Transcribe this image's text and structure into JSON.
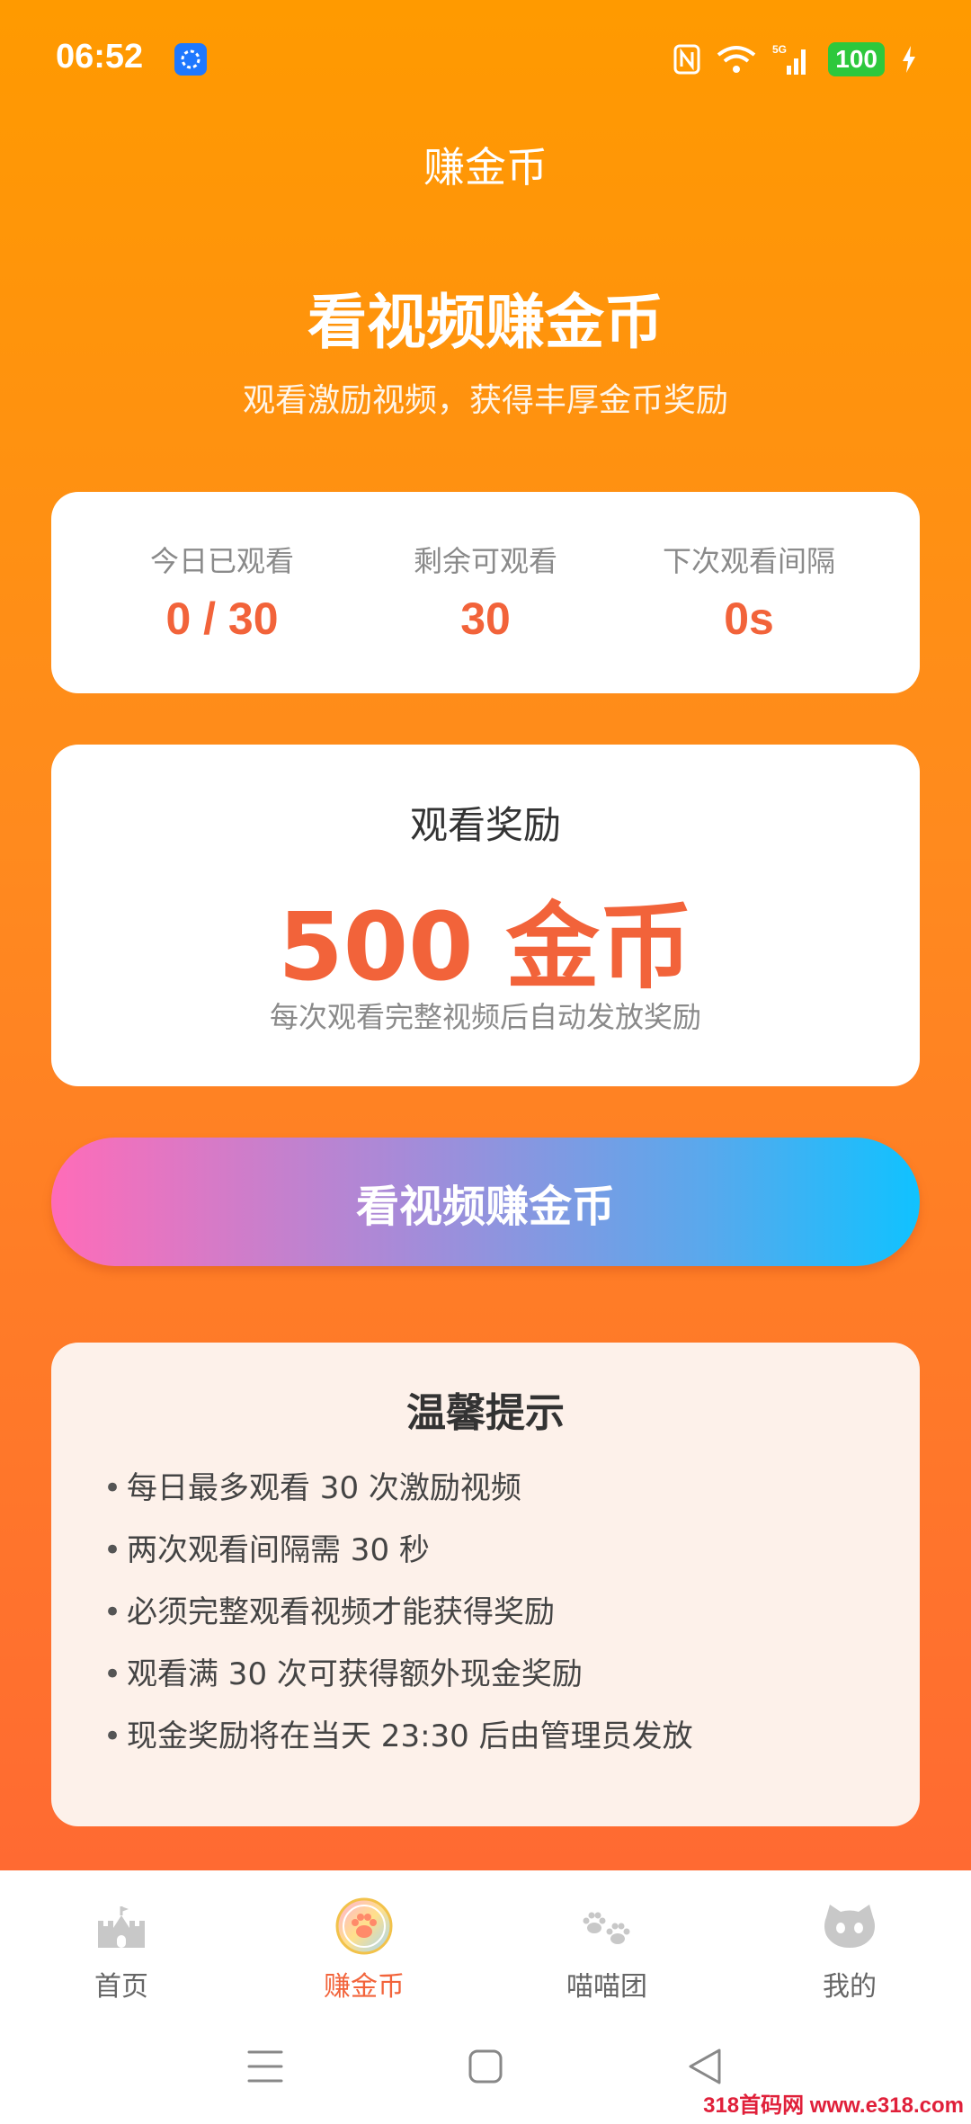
{
  "status_bar": {
    "time": "06:52",
    "battery": "100",
    "network": "5G",
    "icons": [
      "nfc-icon",
      "wifi-icon",
      "signal-icon",
      "charging-icon"
    ]
  },
  "header": {
    "nav_title": "赚金币",
    "hero_title": "看视频赚金币",
    "hero_subtitle": "观看激励视频，获得丰厚金币奖励"
  },
  "stats": [
    {
      "label": "今日已观看",
      "value": "0 / 30"
    },
    {
      "label": "剩余可观看",
      "value": "30"
    },
    {
      "label": "下次观看间隔",
      "value": "0s"
    }
  ],
  "reward": {
    "label": "观看奖励",
    "amount": "500 金币",
    "note": "每次观看完整视频后自动发放奖励"
  },
  "watch_button": {
    "label": "看视频赚金币"
  },
  "tips": {
    "title": "温馨提示",
    "bullet": "•",
    "items": [
      "每日最多观看 30 次激励视频",
      "两次观看间隔需 30 秒",
      "必须完整观看视频才能获得奖励",
      "观看满 30 次可获得额外现金奖励",
      "现金奖励将在当天 23:30 后由管理员发放"
    ]
  },
  "tab_bar": {
    "tabs": [
      {
        "label": "首页",
        "icon": "castle-icon",
        "active": false
      },
      {
        "label": "赚金币",
        "icon": "paw-coin-icon",
        "active": true
      },
      {
        "label": "喵喵团",
        "icon": "paw-prints-icon",
        "active": false
      },
      {
        "label": "我的",
        "icon": "cat-face-icon",
        "active": false
      }
    ]
  },
  "watermark": "318首码网 www.e318.com",
  "colors": {
    "accent": "#f2633a",
    "bg_top": "#ff9a00",
    "bg_bottom": "#ff6a32",
    "tab_inactive": "#c8c8c8"
  }
}
